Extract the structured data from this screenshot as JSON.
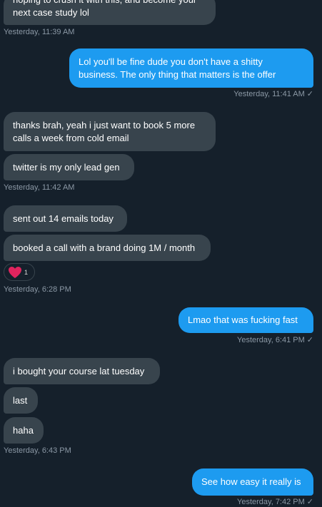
{
  "colors": {
    "background": "#15202b",
    "incoming_bubble": "#38444d",
    "outgoing_bubble": "#1d9bf0",
    "timestamp_text": "#8b98a5",
    "heart": "#e0245e"
  },
  "messages": [
    {
      "direction": "in",
      "text": "hoping to crush it with this, and become your\nnext case study lol"
    },
    {
      "direction": "out",
      "text": "Lol you'll be fine dude you don't have a shitty\nbusiness. The only thing that matters is the offer"
    },
    {
      "direction": "in",
      "text": "thanks brah, yeah i just want to book 5 more\ncalls a week from cold email"
    },
    {
      "direction": "in",
      "text": "twitter is my only lead gen"
    },
    {
      "direction": "in",
      "text": "sent out 14 emails today"
    },
    {
      "direction": "in",
      "text": "booked a call with a brand doing 1M / month"
    },
    {
      "direction": "out",
      "text": "Lmao that was fucking fast"
    },
    {
      "direction": "in",
      "text": "i bought your course lat tuesday"
    },
    {
      "direction": "in",
      "text": "last"
    },
    {
      "direction": "in",
      "text": "haha"
    },
    {
      "direction": "out",
      "text": "See how easy it really is"
    }
  ],
  "timestamps": [
    "Yesterday, 11:39 AM",
    "Yesterday, 11:41 AM",
    "Yesterday, 11:42 AM",
    "Yesterday, 6:28 PM",
    "Yesterday, 6:41 PM",
    "Yesterday, 6:43 PM",
    "Yesterday, 7:42 PM"
  ],
  "read_check": "✓",
  "reaction": {
    "icon": "heart-icon",
    "count": "1"
  }
}
